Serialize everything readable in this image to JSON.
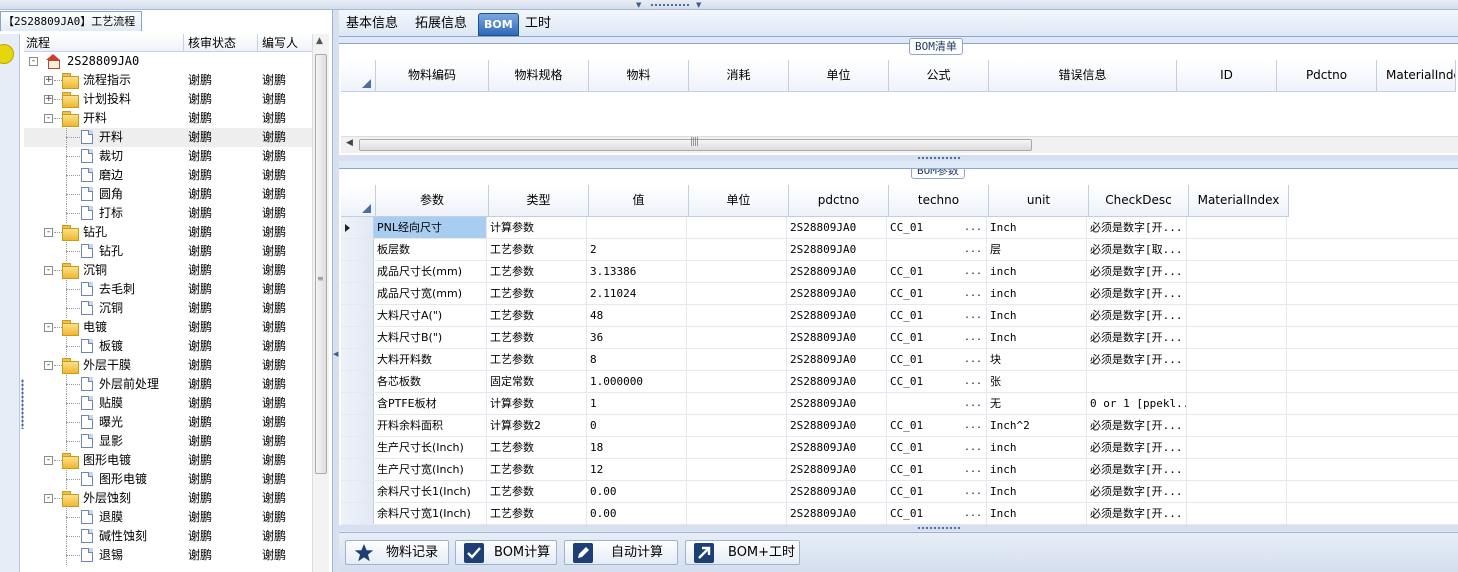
{
  "left_panel": {
    "title": "【2S28809JA0】工艺流程",
    "columns": {
      "flow": "流程",
      "status": "核审状态",
      "author": "编写人"
    },
    "tree": [
      {
        "label": "2S28809JA0",
        "level": 0,
        "type": "root",
        "status": "",
        "author": ""
      },
      {
        "label": "流程指示",
        "level": 1,
        "type": "folder",
        "expander": "+",
        "status": "谢鹏",
        "author": "谢鹏"
      },
      {
        "label": "计划投料",
        "level": 1,
        "type": "folder",
        "expander": "+",
        "status": "谢鹏",
        "author": "谢鹏"
      },
      {
        "label": "开料",
        "level": 1,
        "type": "folder",
        "expander": "-",
        "status": "谢鹏",
        "author": "谢鹏"
      },
      {
        "label": "开料",
        "level": 2,
        "type": "page",
        "status": "谢鹏",
        "author": "谢鹏",
        "selected": true
      },
      {
        "label": "裁切",
        "level": 2,
        "type": "page",
        "status": "谢鹏",
        "author": "谢鹏"
      },
      {
        "label": "磨边",
        "level": 2,
        "type": "page",
        "status": "谢鹏",
        "author": "谢鹏"
      },
      {
        "label": "圆角",
        "level": 2,
        "type": "page",
        "status": "谢鹏",
        "author": "谢鹏"
      },
      {
        "label": "打标",
        "level": 2,
        "type": "page",
        "status": "谢鹏",
        "author": "谢鹏"
      },
      {
        "label": "钻孔",
        "level": 1,
        "type": "folder",
        "expander": "-",
        "status": "谢鹏",
        "author": "谢鹏"
      },
      {
        "label": "钻孔",
        "level": 2,
        "type": "page",
        "status": "谢鹏",
        "author": "谢鹏"
      },
      {
        "label": "沉铜",
        "level": 1,
        "type": "folder",
        "expander": "-",
        "status": "谢鹏",
        "author": "谢鹏"
      },
      {
        "label": "去毛刺",
        "level": 2,
        "type": "page",
        "status": "谢鹏",
        "author": "谢鹏"
      },
      {
        "label": "沉铜",
        "level": 2,
        "type": "page",
        "status": "谢鹏",
        "author": "谢鹏"
      },
      {
        "label": "电镀",
        "level": 1,
        "type": "folder",
        "expander": "-",
        "status": "谢鹏",
        "author": "谢鹏"
      },
      {
        "label": "板镀",
        "level": 2,
        "type": "page",
        "status": "谢鹏",
        "author": "谢鹏"
      },
      {
        "label": "外层干膜",
        "level": 1,
        "type": "folder",
        "expander": "-",
        "status": "谢鹏",
        "author": "谢鹏"
      },
      {
        "label": "外层前处理",
        "level": 2,
        "type": "page",
        "status": "谢鹏",
        "author": "谢鹏"
      },
      {
        "label": "贴膜",
        "level": 2,
        "type": "page",
        "status": "谢鹏",
        "author": "谢鹏"
      },
      {
        "label": "曝光",
        "level": 2,
        "type": "page",
        "status": "谢鹏",
        "author": "谢鹏"
      },
      {
        "label": "显影",
        "level": 2,
        "type": "page",
        "status": "谢鹏",
        "author": "谢鹏"
      },
      {
        "label": "图形电镀",
        "level": 1,
        "type": "folder",
        "expander": "-",
        "status": "谢鹏",
        "author": "谢鹏"
      },
      {
        "label": "图形电镀",
        "level": 2,
        "type": "page",
        "status": "谢鹏",
        "author": "谢鹏"
      },
      {
        "label": "外层蚀刻",
        "level": 1,
        "type": "folder",
        "expander": "-",
        "status": "谢鹏",
        "author": "谢鹏"
      },
      {
        "label": "退膜",
        "level": 2,
        "type": "page",
        "status": "谢鹏",
        "author": "谢鹏"
      },
      {
        "label": "碱性蚀刻",
        "level": 2,
        "type": "page",
        "status": "谢鹏",
        "author": "谢鹏"
      },
      {
        "label": "退锡",
        "level": 2,
        "type": "page",
        "status": "谢鹏",
        "author": "谢鹏"
      }
    ]
  },
  "tabs": [
    {
      "label": "基本信息",
      "active": false
    },
    {
      "label": "拓展信息",
      "active": false
    },
    {
      "label": "BOM",
      "active": true
    },
    {
      "label": "工时",
      "active": false
    }
  ],
  "bom_list": {
    "title": "BOM清单",
    "columns": [
      "物料编码",
      "物料规格",
      "物料",
      "消耗",
      "单位",
      "公式",
      "错误信息",
      "ID",
      "Pdctno",
      "MaterialIndex"
    ]
  },
  "bom_params": {
    "title": "BOM参数",
    "columns": [
      "参数",
      "类型",
      "值",
      "单位",
      "pdctno",
      "techno",
      "unit",
      "CheckDesc",
      "MaterialIndex"
    ],
    "rows": [
      {
        "param": "PNL经向尺寸",
        "type": "计算参数",
        "value": "",
        "unit_cn": "",
        "pdctno": "2S28809JA0",
        "techno": "CC_01",
        "unit": "Inch",
        "check": "必须是数字[开...",
        "selected": true
      },
      {
        "param": "板层数",
        "type": "工艺参数",
        "value": "2",
        "unit_cn": "",
        "pdctno": "2S28809JA0",
        "techno": "",
        "unit": "层",
        "check": "必须是数字[取..."
      },
      {
        "param": "成品尺寸长(mm)",
        "type": "工艺参数",
        "value": "3.13386",
        "unit_cn": "",
        "pdctno": "2S28809JA0",
        "techno": "CC_01",
        "unit": "inch",
        "check": "必须是数字[开..."
      },
      {
        "param": "成品尺寸宽(mm)",
        "type": "工艺参数",
        "value": "2.11024",
        "unit_cn": "",
        "pdctno": "2S28809JA0",
        "techno": "CC_01",
        "unit": "inch",
        "check": "必须是数字[开..."
      },
      {
        "param": "大料尺寸A(\")",
        "type": "工艺参数",
        "value": "48",
        "unit_cn": "",
        "pdctno": "2S28809JA0",
        "techno": "CC_01",
        "unit": "Inch",
        "check": "必须是数字[开..."
      },
      {
        "param": "大料尺寸B(\")",
        "type": "工艺参数",
        "value": "36",
        "unit_cn": "",
        "pdctno": "2S28809JA0",
        "techno": "CC_01",
        "unit": "Inch",
        "check": "必须是数字[开..."
      },
      {
        "param": "大料开料数",
        "type": "工艺参数",
        "value": "8",
        "unit_cn": "",
        "pdctno": "2S28809JA0",
        "techno": "CC_01",
        "unit": "块",
        "check": "必须是数字[开..."
      },
      {
        "param": "各芯板数",
        "type": "固定常数",
        "value": "1.000000",
        "unit_cn": "",
        "pdctno": "2S28809JA0",
        "techno": "CC_01",
        "unit": "张",
        "check": ""
      },
      {
        "param": "含PTFE板材",
        "type": "计算参数",
        "value": "1",
        "unit_cn": "",
        "pdctno": "2S28809JA0",
        "techno": "",
        "unit": "无",
        "check": "0 or 1 [ppekl..."
      },
      {
        "param": "开料余料面积",
        "type": "计算参数2",
        "value": "0",
        "unit_cn": "",
        "pdctno": "2S28809JA0",
        "techno": "CC_01",
        "unit": "Inch^2",
        "check": "必须是数字[开..."
      },
      {
        "param": "生产尺寸长(Inch)",
        "type": "工艺参数",
        "value": "18",
        "unit_cn": "",
        "pdctno": "2S28809JA0",
        "techno": "CC_01",
        "unit": "inch",
        "check": "必须是数字[开..."
      },
      {
        "param": "生产尺寸宽(Inch)",
        "type": "工艺参数",
        "value": "12",
        "unit_cn": "",
        "pdctno": "2S28809JA0",
        "techno": "CC_01",
        "unit": "inch",
        "check": "必须是数字[开..."
      },
      {
        "param": "余料尺寸长1(Inch)",
        "type": "工艺参数",
        "value": "0.00",
        "unit_cn": "",
        "pdctno": "2S28809JA0",
        "techno": "CC_01",
        "unit": "Inch",
        "check": "必须是数字[开..."
      },
      {
        "param": "余料尺寸宽1(Inch)",
        "type": "工艺参数",
        "value": "0.00",
        "unit_cn": "",
        "pdctno": "2S28809JA0",
        "techno": "CC_01",
        "unit": "Inch",
        "check": "必须是数字[开..."
      }
    ]
  },
  "toolbar": {
    "buttons": [
      {
        "label": "物料记录",
        "icon": "star-icon"
      },
      {
        "label": "BOM计算",
        "icon": "check-icon"
      },
      {
        "label": "自动计算",
        "icon": "pencil-icon"
      },
      {
        "label": "BOM+工时",
        "icon": "arrow-icon"
      }
    ]
  },
  "colors": {
    "accent": "#2f69b8",
    "selection": "#a8cdf0",
    "border": "#8ea6cb"
  }
}
